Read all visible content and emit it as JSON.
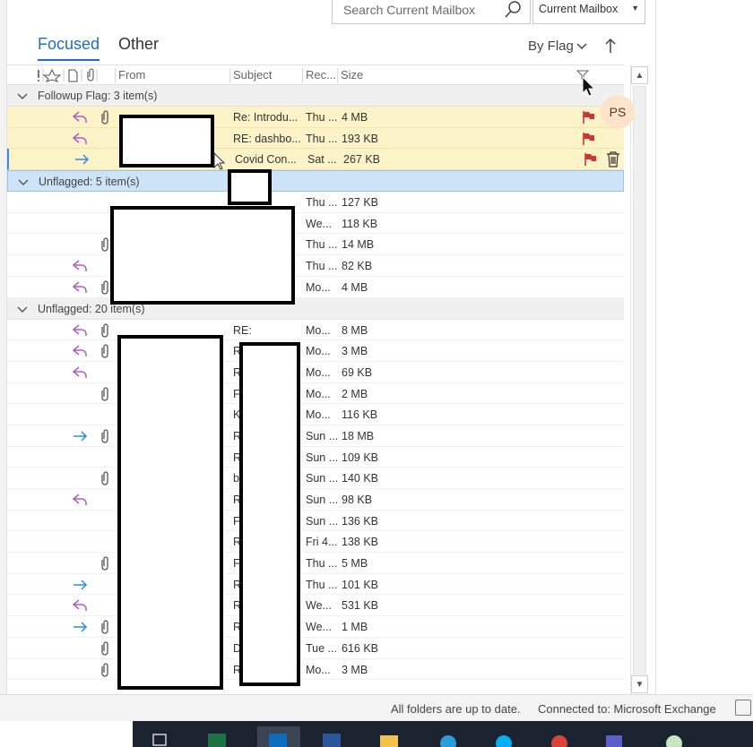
{
  "search": {
    "placeholder": "Search Current Mailbox",
    "scope": "Current Mailbox"
  },
  "tabs": {
    "focused": "Focused",
    "other": "Other"
  },
  "arrange": {
    "label": "By Flag"
  },
  "columns": {
    "from": "From",
    "subject": "Subject",
    "received": "Rec...",
    "size": "Size"
  },
  "avatar": "PS",
  "groups": [
    {
      "label": "Followup Flag: 3 item(s)"
    },
    {
      "label": "Unflagged: 5 item(s)"
    },
    {
      "label": "Unflagged: 20 item(s)"
    }
  ],
  "rows": [
    {
      "subject": "Re: Introdu...",
      "received": "Thu ...",
      "size": "4 MB"
    },
    {
      "subject": "RE: dashbo...",
      "received": "Thu ...",
      "size": "193 KB"
    },
    {
      "subject": "Covid Con...",
      "received": "Sat ...",
      "size": "267 KB"
    },
    {
      "received": "Thu ...",
      "size": "127 KB"
    },
    {
      "received": "We...",
      "size": "118 KB"
    },
    {
      "received": "Thu ...",
      "size": "14 MB"
    },
    {
      "received": "Thu ...",
      "size": "82 KB"
    },
    {
      "received": "Mo...",
      "size": "4 MB"
    },
    {
      "subject": "RE:",
      "received": "Mo...",
      "size": "8 MB"
    },
    {
      "subject": "R",
      "received": "Mo...",
      "size": "3 MB"
    },
    {
      "subject": "R",
      "received": "Mo...",
      "size": "69 KB"
    },
    {
      "subject": "F",
      "received": "Mo...",
      "size": "2 MB"
    },
    {
      "subject": "K",
      "received": "Mo...",
      "size": "116 KB"
    },
    {
      "subject": "R",
      "received": "Sun ...",
      "size": "18 MB"
    },
    {
      "subject": "R",
      "received": "Sun ...",
      "size": "109 KB"
    },
    {
      "subject": "b",
      "received": "Sun ...",
      "size": "140 KB"
    },
    {
      "subject": "R",
      "received": "Sun ...",
      "size": "98 KB"
    },
    {
      "subject": "F",
      "received": "Sun ...",
      "size": "136 KB"
    },
    {
      "subject": "R",
      "received": "Fri 4...",
      "size": "138 KB"
    },
    {
      "subject": "F",
      "received": "Thu ...",
      "size": "5 MB"
    },
    {
      "subject": "R",
      "received": "Thu ...",
      "size": "101 KB"
    },
    {
      "subject": "R",
      "received": "We...",
      "size": "531 KB"
    },
    {
      "subject": "R",
      "received": "We...",
      "size": "1 MB"
    },
    {
      "subject": "D",
      "received": "Tue ...",
      "size": "616 KB"
    },
    {
      "subject": "R",
      "received": "Mo...",
      "size": "3 MB"
    }
  ],
  "status": {
    "sync": "All folders are up to date.",
    "connection": "Connected to: Microsoft Exchange"
  },
  "colors": {
    "accent": "#1e6fbf",
    "reply": "#b05cc7",
    "forward": "#2f8fd6",
    "flag": "#d13438",
    "flagged_row": "#fdf3c8",
    "selected_group": "#cde3f7"
  }
}
